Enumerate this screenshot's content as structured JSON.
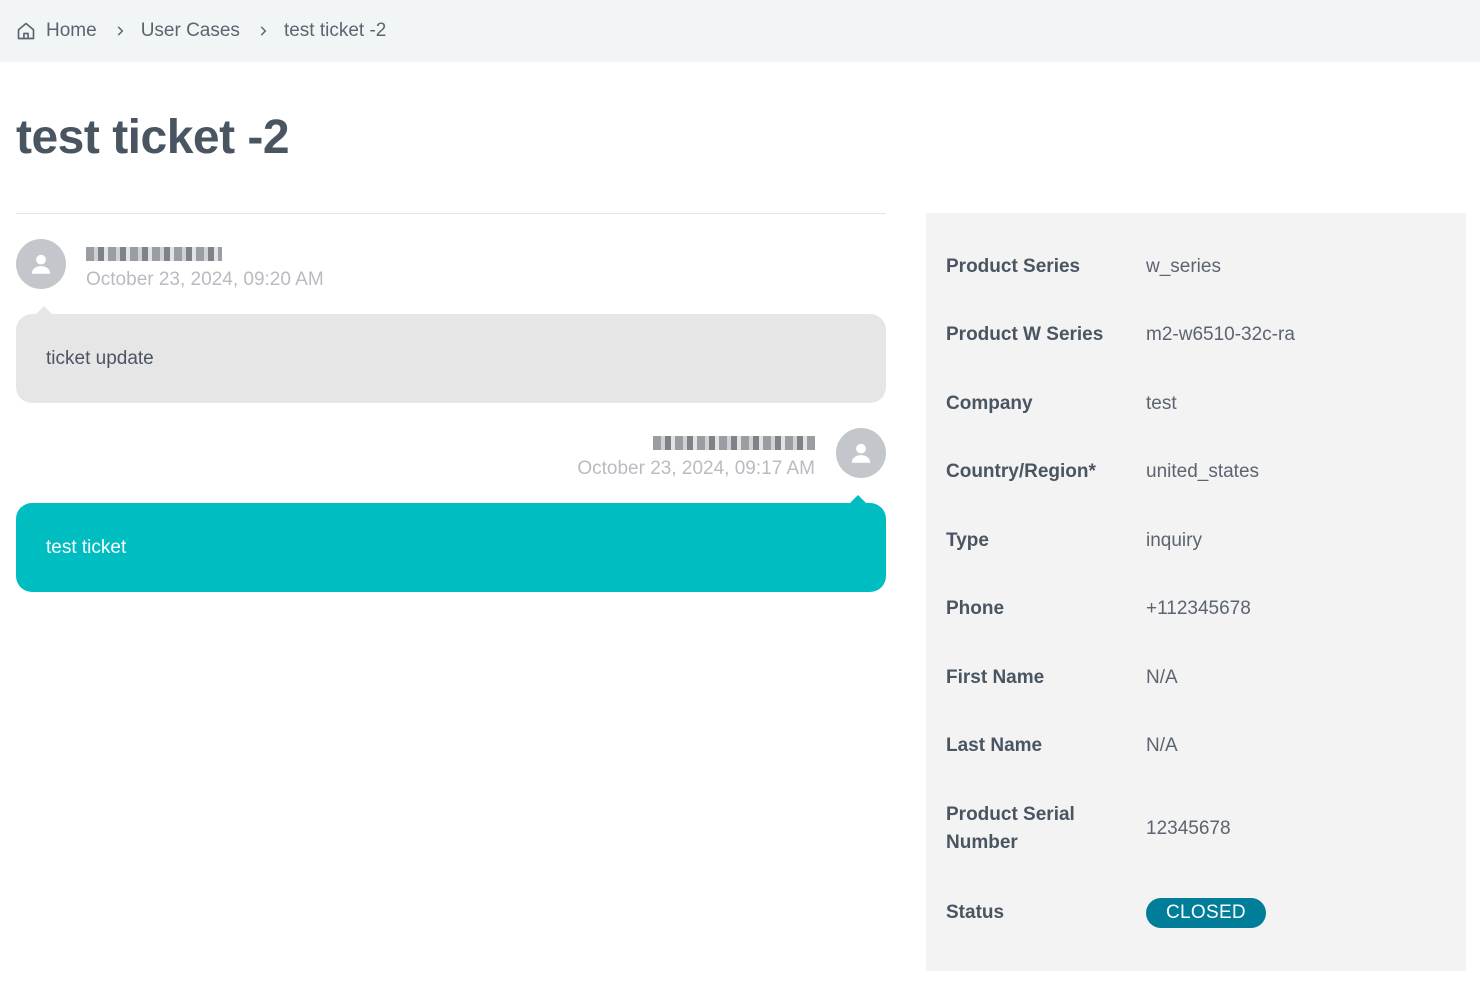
{
  "breadcrumb": {
    "home": "Home",
    "section": "User Cases",
    "current": "test ticket -2"
  },
  "page": {
    "title": "test ticket -2"
  },
  "messages": [
    {
      "author": "redacted",
      "time": "October 23, 2024, 09:20 AM",
      "text": "ticket update",
      "side": "left",
      "color": "#e6e6e6"
    },
    {
      "author": "redacted",
      "time": "October 23, 2024, 09:17 AM",
      "text": "test ticket",
      "side": "right",
      "color": "#00bdc1"
    }
  ],
  "details": [
    {
      "label": "Product Series",
      "value": "w_series"
    },
    {
      "label": "Product W Series",
      "value": "m2-w6510-32c-ra"
    },
    {
      "label": "Company",
      "value": "test"
    },
    {
      "label": "Country/Region*",
      "value": "united_states"
    },
    {
      "label": "Type",
      "value": "inquiry"
    },
    {
      "label": "Phone",
      "value": "+112345678"
    },
    {
      "label": "First Name",
      "value": "N/A"
    },
    {
      "label": "Last Name",
      "value": "N/A"
    },
    {
      "label": "Product Serial Number",
      "value": "12345678"
    },
    {
      "label": "Status",
      "value": "CLOSED",
      "badge_color": "#007d99"
    }
  ]
}
